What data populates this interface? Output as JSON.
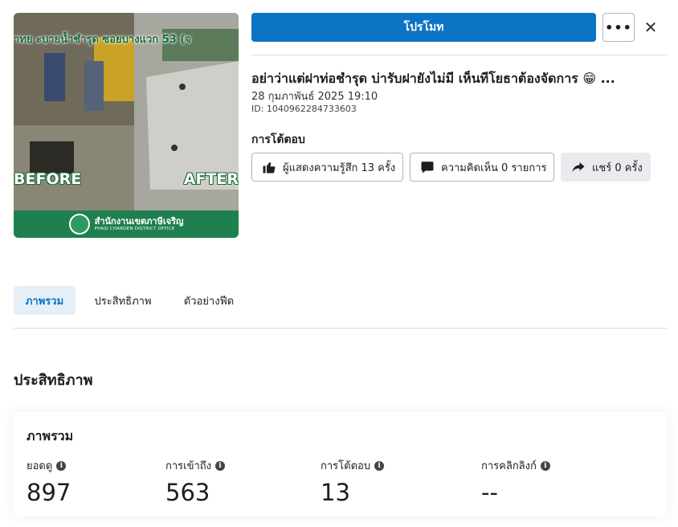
{
  "media": {
    "overlay_title": "าทย ะบายน้ำชำรุด ซอยบางแวก 53 (จ",
    "before_label": "BEFORE",
    "after_label": "AFTER",
    "banner_th": "สำนักงานเขตภาษีเจริญ",
    "banner_en": "PHASI CHAROEN DISTRICT OFFICE"
  },
  "header": {
    "promote_label": "โปรโมท",
    "more_label": "•••",
    "close_label": "✕"
  },
  "post": {
    "title": "อย่าว่าแต่ฝาท่อชำรุด บ่ารับฝายังไม่มี เห็นทีโยธาต้องจัดการ 😁 ...",
    "date": "28 กุมภาพันธ์ 2025 19:10",
    "id": "ID: 1040962284733603"
  },
  "engagement": {
    "section_label": "การโต้ตอบ",
    "likes_label": "ผู้แสดงความรู้สึก 13 ครั้ง",
    "comments_label": "ความคิดเห็น 0 รายการ",
    "shares_label": "แชร์ 0 ครั้ง"
  },
  "tabs": [
    {
      "label": "ภาพรวม"
    },
    {
      "label": "ประสิทธิภาพ"
    },
    {
      "label": "ตัวอย่างฟีด"
    }
  ],
  "performance": {
    "heading": "ประสิทธิภาพ",
    "card_title": "ภาพรวม",
    "metrics": [
      {
        "label": "ยอดดู",
        "value": "897"
      },
      {
        "label": "การเข้าถึง",
        "value": "563"
      },
      {
        "label": "การโต้ตอบ",
        "value": "13"
      },
      {
        "label": "การคลิกลิงก์",
        "value": "--"
      }
    ]
  },
  "colors": {
    "accent": "#0b74c4",
    "banner_green": "#1e7f4f"
  }
}
